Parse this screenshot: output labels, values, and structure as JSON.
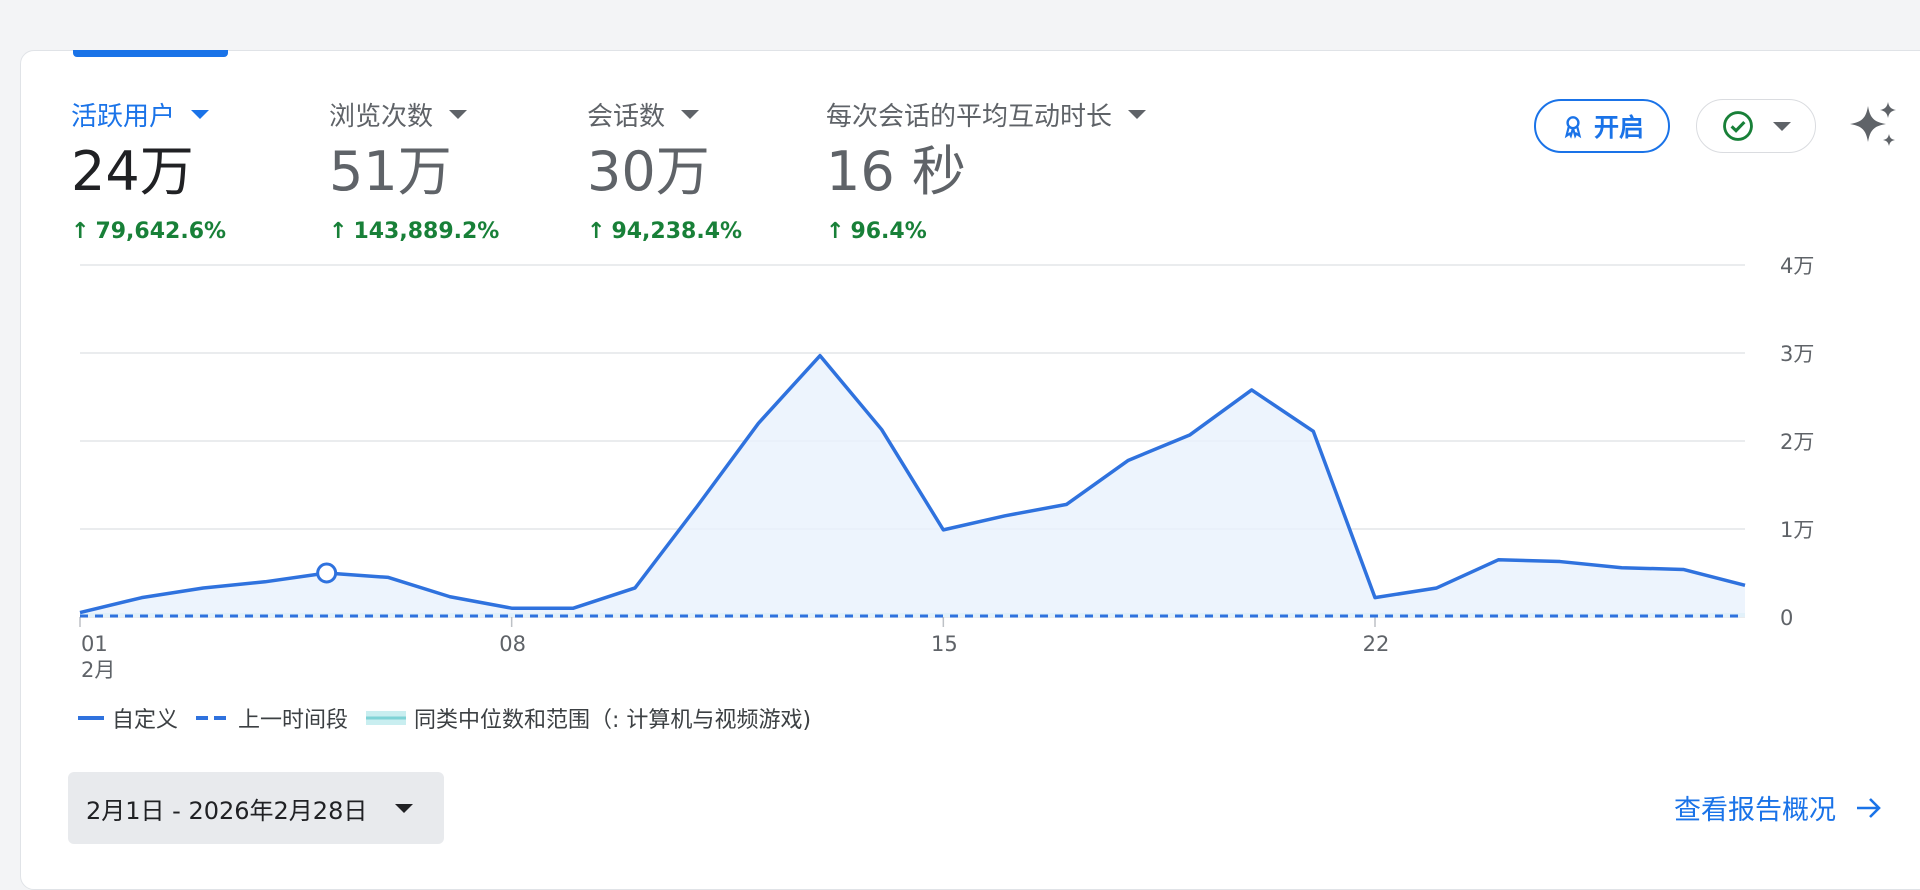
{
  "metrics": [
    {
      "label": "活跃用户",
      "value": "24万",
      "change": "79,642.6%",
      "active": true
    },
    {
      "label": "浏览次数",
      "value": "51万",
      "change": "143,889.2%",
      "active": false
    },
    {
      "label": "会话数",
      "value": "30万",
      "change": "94,238.4%",
      "active": false
    },
    {
      "label": "每次会话的平均互动时长",
      "value": "16 秒",
      "change": "96.4%",
      "active": false
    }
  ],
  "actions": {
    "kaiqi_label": "开启"
  },
  "legend": {
    "custom": "自定义",
    "previous": "上一时间段",
    "benchmark": "同类中位数和范围（: 计算机与视频游戏)"
  },
  "date_range": "2月1日 - 2026年2月28日",
  "report_link": "查看报告概况",
  "colors": {
    "accent": "#1a73e8",
    "positive": "#188038",
    "series": "#2f72de",
    "benchmark": "#7fd3d6"
  },
  "chart_data": {
    "type": "line",
    "x": [
      1,
      2,
      3,
      4,
      5,
      6,
      7,
      8,
      9,
      10,
      11,
      12,
      13,
      14,
      15,
      16,
      17,
      18,
      19,
      20,
      21,
      22,
      23,
      24,
      25,
      26,
      27,
      28
    ],
    "x_ticks": [
      {
        "value": 1,
        "label": "01",
        "sublabel": "2月"
      },
      {
        "value": 8,
        "label": "08"
      },
      {
        "value": 15,
        "label": "15"
      },
      {
        "value": 22,
        "label": "22"
      }
    ],
    "y_ticks": [
      {
        "value": 0,
        "label": "0"
      },
      {
        "value": 10000,
        "label": "1万"
      },
      {
        "value": 20000,
        "label": "2万"
      },
      {
        "value": 30000,
        "label": "3万"
      },
      {
        "value": 40000,
        "label": "4万"
      }
    ],
    "ylim": [
      0,
      40000
    ],
    "series": [
      {
        "name": "自定义",
        "style": "solid",
        "values": [
          500,
          2200,
          3300,
          4000,
          5000,
          4500,
          2300,
          1000,
          1000,
          3300,
          12500,
          22000,
          29700,
          21300,
          9900,
          11500,
          12800,
          17800,
          20700,
          25800,
          21100,
          2200,
          3300,
          6500,
          6300,
          5600,
          5400,
          3600
        ]
      },
      {
        "name": "上一时间段",
        "style": "dashed",
        "values": [
          0,
          0,
          0,
          0,
          0,
          0,
          0,
          0,
          0,
          0,
          0,
          0,
          0,
          0,
          0,
          0,
          0,
          0,
          0,
          0,
          0,
          0,
          0,
          0,
          0,
          0,
          0,
          0
        ]
      }
    ],
    "highlight_point": {
      "x": 5
    },
    "grid": true
  }
}
